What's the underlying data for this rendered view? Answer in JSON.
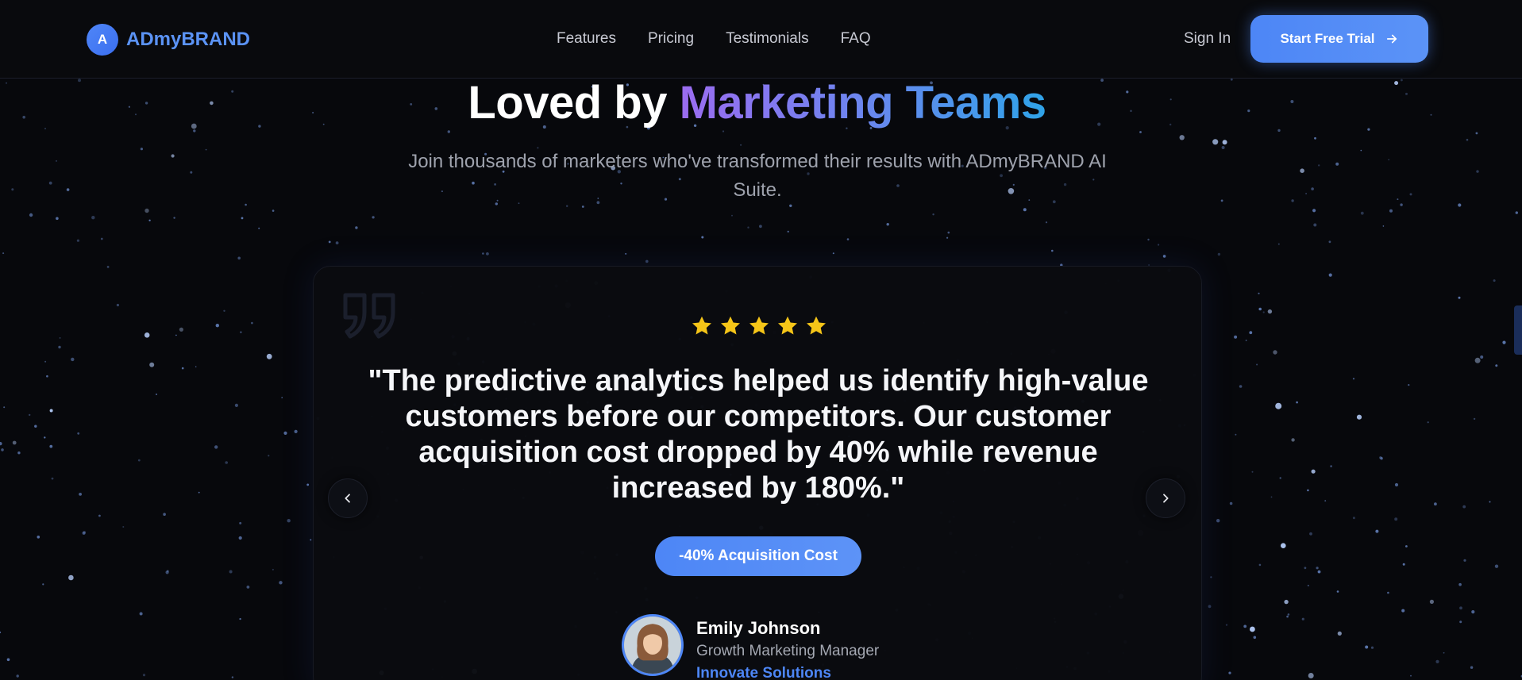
{
  "brand": {
    "logo_letter": "A",
    "name": "ADmyBRAND"
  },
  "nav": {
    "links": [
      "Features",
      "Pricing",
      "Testimonials",
      "FAQ"
    ],
    "sign_in": "Sign In",
    "cta_label": "Start Free Trial"
  },
  "section": {
    "title_plain": "Loved by",
    "title_highlight": "Marketing Teams",
    "subtitle": "Join thousands of marketers who've transformed their results with ADmyBRAND AI Suite."
  },
  "testimonial": {
    "rating": 5,
    "rating_max": 5,
    "quote": "\"The predictive analytics helped us identify high-value customers before our competitors. Our customer acquisition cost dropped by 40% while revenue increased by 180%.\"",
    "metric": "-40% Acquisition Cost",
    "author_name": "Emily Johnson",
    "author_role": "Growth Marketing Manager",
    "author_company": "Innovate Solutions"
  },
  "colors": {
    "accent": "#4d86f6",
    "star": "#f5c518",
    "background": "#07080c",
    "gradient_start": "#9b6cf0",
    "gradient_end": "#2fa3e8"
  },
  "icons": {
    "arrow_cta": "arrow-right-icon",
    "prev": "chevron-left-icon",
    "next": "chevron-right-icon",
    "quote": "quote-mark-icon",
    "star": "star-icon"
  }
}
